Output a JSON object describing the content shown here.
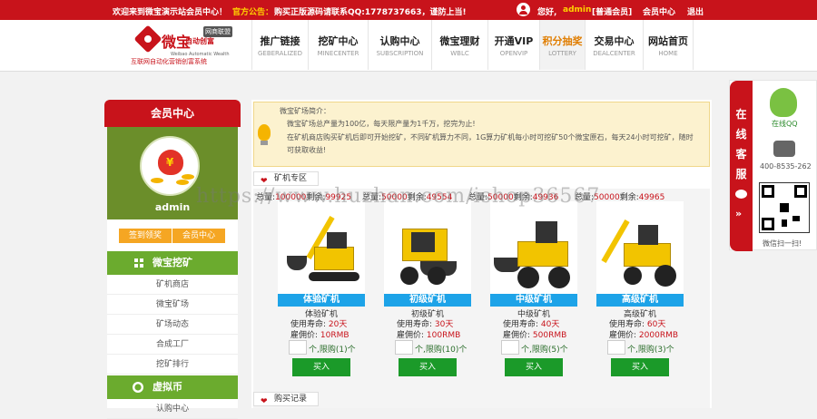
{
  "topbar": {
    "welcome": "欢迎来到微宝演示站会员中心！",
    "notice_label": "官方公告：",
    "notice": "购买正版源码请联系QQ:1778737663，谨防上当!",
    "hello": "您好,",
    "username": "admin",
    "level": "[普通会员]",
    "member_center": "会员中心",
    "logout": "退出"
  },
  "logo": {
    "name": "微宝",
    "sub": "自动创富",
    "badge": "网商联盟",
    "en": "Weibao Automatic Wealth",
    "slogan": "互联网自动化营销创富系统"
  },
  "nav": [
    {
      "cn": "推广链接",
      "en": "GEBERALIZED"
    },
    {
      "cn": "挖矿中心",
      "en": "MINECENTER"
    },
    {
      "cn": "认购中心",
      "en": "SUBSCRIPTION"
    },
    {
      "cn": "微宝理财",
      "en": "WBLC"
    },
    {
      "cn": "开通VIP",
      "en": "OPENVIP"
    },
    {
      "cn": "积分抽奖",
      "en": "LOTTERY"
    },
    {
      "cn": "交易中心",
      "en": "DEALCENTER"
    },
    {
      "cn": "网站首页",
      "en": "HOME"
    }
  ],
  "sidebar": {
    "title": "会员中心",
    "username": "admin",
    "btn_checkin": "签到领奖",
    "btn_member": "会员中心",
    "section1": "微宝挖矿",
    "links1": [
      "矿机商店",
      "微宝矿场",
      "矿场动态",
      "合成工厂",
      "挖矿排行"
    ],
    "section2": "虚拟币",
    "links2": [
      "认购中心"
    ]
  },
  "intro": {
    "title": "微宝矿场简介：",
    "p1": "微宝矿场总产量为100亿，每天限产量为1千万，挖完为止!",
    "p2": "在矿机商店购买矿机后即可开始挖矿，不同矿机算力不同，1G算力矿机每小时可挖矿50个微宝原石，每天24小时可挖矿，随时可获取收益!"
  },
  "zone_title": "矿机专区",
  "records_title": "购买记录",
  "products": [
    {
      "total_label": "总量:",
      "total": "100000",
      "remain_label": "剩余:",
      "remain": "99925",
      "label": "体验矿机",
      "name": "体验矿机",
      "life_label": "使用寿命:",
      "life": "20天",
      "price_label": "雇佣价:",
      "price": "10RMB",
      "limit": "个,限购(1)个",
      "buy": "买入"
    },
    {
      "total_label": "总量:",
      "total": "50000",
      "remain_label": "剩余:",
      "remain": "49554",
      "label": "初级矿机",
      "name": "初级矿机",
      "life_label": "使用寿命:",
      "life": "30天",
      "price_label": "雇佣价:",
      "price": "100RMB",
      "limit": "个,限购(10)个",
      "buy": "买入"
    },
    {
      "total_label": "总量:",
      "total": "50000",
      "remain_label": "剩余:",
      "remain": "49936",
      "label": "中级矿机",
      "name": "中级矿机",
      "life_label": "使用寿命:",
      "life": "40天",
      "price_label": "雇佣价:",
      "price": "500RMB",
      "limit": "个,限购(5)个",
      "buy": "买入"
    },
    {
      "total_label": "总量:",
      "total": "50000",
      "remain_label": "剩余:",
      "remain": "49965",
      "label": "高级矿机",
      "name": "高级矿机",
      "life_label": "使用寿命:",
      "life": "60天",
      "price_label": "雇佣价:",
      "price": "2000RMB",
      "limit": "个,限购(3)个",
      "buy": "买入"
    }
  ],
  "right_panel": {
    "vertical": "在线客服",
    "qq_label": "在线QQ",
    "phone": "400-8535-262",
    "scan": "微信扫一扫!"
  },
  "watermark": "https://www.huzhan.com/ishop36567",
  "colors": {
    "brand_red": "#c8131b",
    "green": "#6bab2e",
    "blue": "#1da3e8",
    "orange": "#f5a623"
  }
}
